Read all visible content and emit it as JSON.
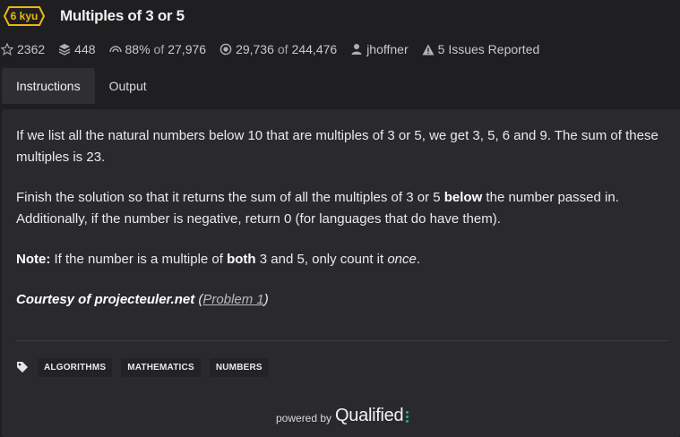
{
  "header": {
    "rank": "6 kyu",
    "title": "Multiples of 3 or 5"
  },
  "stats": {
    "stars": "2362",
    "collections": "448",
    "satisfaction_pct": "88%",
    "satisfaction_of": "of",
    "satisfaction_total": "27,976",
    "completed": "29,736",
    "completed_of": "of",
    "completed_total": "244,476",
    "author": "jhoffner",
    "issues": "5 Issues Reported"
  },
  "tabs": {
    "instructions": "Instructions",
    "output": "Output"
  },
  "description": {
    "p1": "If we list all the natural numbers below 10 that are multiples of 3 or 5, we get 3, 5, 6 and 9. The sum of these multiples is 23.",
    "p2_a": "Finish the solution so that it returns the sum of all the multiples of 3 or 5 ",
    "p2_bold": "below",
    "p2_b": " the number passed in. Additionally, if the number is negative, return 0 (for languages that do have them).",
    "p3_bold1": "Note:",
    "p3_a": " If the number is a multiple of ",
    "p3_bold2": "both",
    "p3_b": " 3 and 5, only count it ",
    "p3_italic": "once",
    "p3_c": ".",
    "p4_bold": "Courtesy of projecteuler.net",
    "p4_open": " (",
    "p4_link": "Problem 1",
    "p4_close": ")"
  },
  "tags": [
    "ALGORITHMS",
    "MATHEMATICS",
    "NUMBERS"
  ],
  "footer": {
    "powered_by": "powered by",
    "brand": "Qualified"
  },
  "colors": {
    "rank": "#ecb613",
    "background": "#1f1f22",
    "panel": "#2a2a2e",
    "brand_dots": "#2bb673"
  },
  "icons": {
    "stars": "star-icon",
    "collections": "stack-icon",
    "satisfaction": "eye-rainbow-icon",
    "completed": "target-icon",
    "author": "user-icon",
    "issues": "warning-icon",
    "tags": "tag-icon"
  }
}
